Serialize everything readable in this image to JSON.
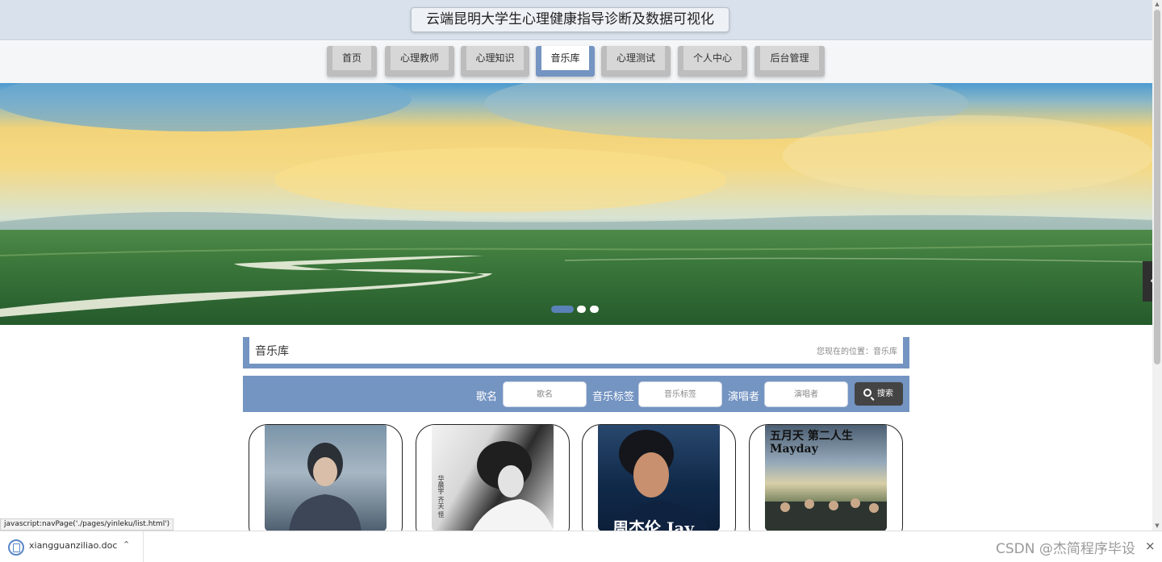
{
  "header": {
    "title": "云端昆明大学生心理健康指导诊断及数据可视化"
  },
  "nav": {
    "items": [
      {
        "label": "首页"
      },
      {
        "label": "心理教师"
      },
      {
        "label": "心理知识"
      },
      {
        "label": "音乐库"
      },
      {
        "label": "心理测试"
      },
      {
        "label": "个人中心"
      },
      {
        "label": "后台管理"
      }
    ],
    "active": "音乐库"
  },
  "banner": {
    "slide_count": 3,
    "active_slide": 1
  },
  "section": {
    "title": "音乐库",
    "breadcrumb": "您现在的位置：音乐库"
  },
  "search": {
    "fields": [
      {
        "label": "歌名",
        "placeholder": "歌名",
        "value": ""
      },
      {
        "label": "音乐标签",
        "placeholder": "音乐标签",
        "value": ""
      },
      {
        "label": "演唱者",
        "placeholder": "演唱者",
        "value": ""
      }
    ],
    "button_label": "搜索"
  },
  "cards": [
    {
      "cover_text": ""
    },
    {
      "cover_text": "华晨宇 齐天 怪"
    },
    {
      "cover_text": "周杰伦 Jay"
    },
    {
      "cover_text": "五月天 第二人生 Mayday"
    }
  ],
  "status_bar": {
    "url": "javascript:navPage('./pages/yinleku/list.html')"
  },
  "download_bar": {
    "file_name": "xiangguanziliao.doc",
    "watermark": "CSDN @杰简程序毕设"
  },
  "colors": {
    "accent": "#7494c2",
    "header_bg": "#d9e2ec",
    "button_dark": "#444444"
  }
}
